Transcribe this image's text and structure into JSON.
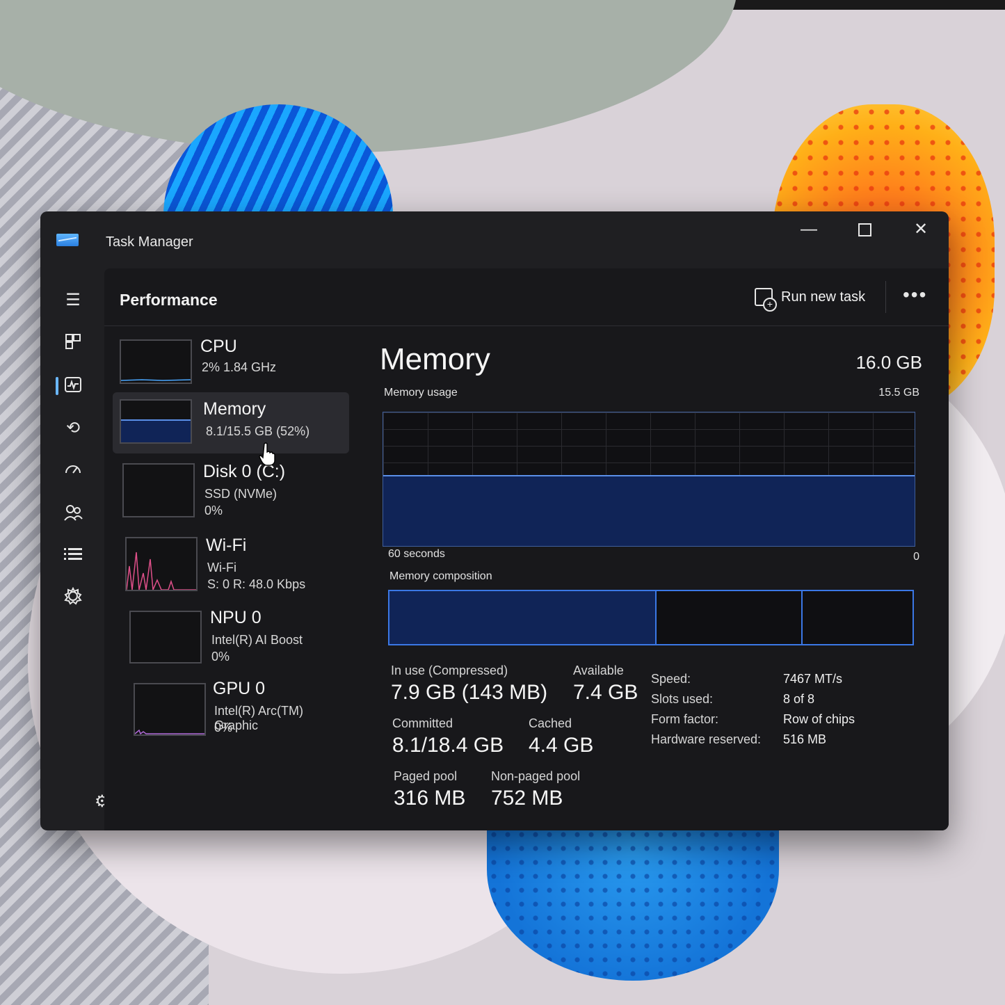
{
  "window": {
    "title": "Task Manager"
  },
  "header": {
    "page_title": "Performance",
    "run_task_label": "Run new task",
    "more_label": "•••"
  },
  "nav_icons": [
    "hamburger-menu-icon",
    "processes-icon",
    "performance-icon",
    "app-history-icon",
    "startup-apps-icon",
    "users-icon",
    "details-icon",
    "services-icon"
  ],
  "devices": [
    {
      "name": "CPU",
      "line1": "2%  1.84 GHz",
      "line2": ""
    },
    {
      "name": "Memory",
      "line1": "8.1/15.5 GB (52%)",
      "line2": "",
      "selected": true
    },
    {
      "name": "Disk 0 (C:)",
      "line1": "SSD (NVMe)",
      "line2": "0%"
    },
    {
      "name": "Wi-Fi",
      "line1": "Wi-Fi",
      "line2": "S: 0  R: 48.0 Kbps"
    },
    {
      "name": "NPU 0",
      "line1": "Intel(R) AI Boost",
      "line2": "0%"
    },
    {
      "name": "GPU 0",
      "line1": "Intel(R) Arc(TM) Graphic",
      "line2": "0%"
    }
  ],
  "memory": {
    "title": "Memory",
    "total": "16.0 GB",
    "usage_label": "Memory usage",
    "usage_max": "15.5 GB",
    "time_label": "60 seconds",
    "time_end": "0",
    "usage_fraction": 0.52,
    "composition_label": "Memory composition",
    "composition": [
      0.51,
      0.28,
      0.21
    ],
    "stats": {
      "in_use_label": "In use (Compressed)",
      "in_use": "7.9 GB (143 MB)",
      "available_label": "Available",
      "available": "7.4 GB",
      "committed_label": "Committed",
      "committed": "8.1/18.4 GB",
      "cached_label": "Cached",
      "cached": "4.4 GB",
      "paged_label": "Paged pool",
      "paged": "316 MB",
      "nonpaged_label": "Non-paged pool",
      "nonpaged": "752 MB"
    },
    "specs": [
      {
        "k": "Speed:",
        "v": "7467 MT/s"
      },
      {
        "k": "Slots used:",
        "v": "8 of 8"
      },
      {
        "k": "Form factor:",
        "v": "Row of chips"
      },
      {
        "k": "Hardware reserved:",
        "v": "516 MB"
      }
    ]
  }
}
